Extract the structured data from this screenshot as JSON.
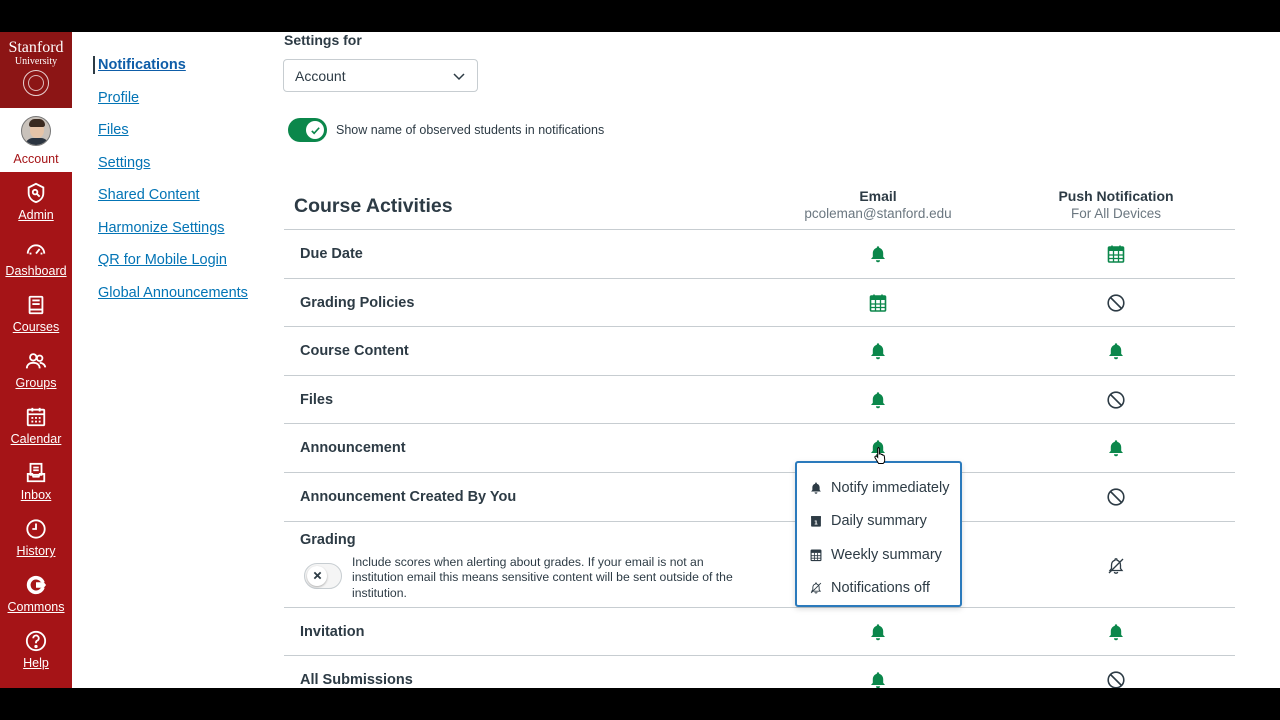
{
  "colors": {
    "nav_bg": "#a51417",
    "logo_bg": "#8c1515",
    "accent_green": "#0b874b",
    "link": "#0374b5",
    "menu_border": "#2b7abc"
  },
  "logo": {
    "line1": "Stanford",
    "line2": "University"
  },
  "global_nav": [
    {
      "label": "Account",
      "icon": "avatar"
    },
    {
      "label": "Admin",
      "icon": "shield-key-icon"
    },
    {
      "label": "Dashboard",
      "icon": "speedometer-icon"
    },
    {
      "label": "Courses",
      "icon": "book-icon"
    },
    {
      "label": "Groups",
      "icon": "people-icon"
    },
    {
      "label": "Calendar",
      "icon": "calendar-icon"
    },
    {
      "label": "Inbox",
      "icon": "inbox-icon"
    },
    {
      "label": "History",
      "icon": "clock-icon"
    },
    {
      "label": "Commons",
      "icon": "commons-icon"
    },
    {
      "label": "Help",
      "icon": "question-icon"
    }
  ],
  "sub_nav": [
    "Notifications",
    "Profile",
    "Files",
    "Settings",
    "Shared Content",
    "Harmonize Settings",
    "QR for Mobile Login",
    "Global Announcements"
  ],
  "settings_for": {
    "label": "Settings for",
    "selected": "Account"
  },
  "observed_toggle": {
    "label": "Show name of observed students in notifications",
    "on": true
  },
  "table": {
    "title": "Course Activities",
    "email_header": "Email",
    "email_sub": "pcoleman@stanford.edu",
    "push_header": "Push Notification",
    "push_sub": "For All Devices",
    "rows": [
      {
        "label": "Due Date",
        "email": "bell",
        "push": "calendar"
      },
      {
        "label": "Grading Policies",
        "email": "calendar",
        "push": "off"
      },
      {
        "label": "Course Content",
        "email": "bell",
        "push": "bell"
      },
      {
        "label": "Files",
        "email": "bell",
        "push": "off"
      },
      {
        "label": "Announcement",
        "email": "bell",
        "push": "bell"
      },
      {
        "label": "Announcement Created By You",
        "email": "",
        "push": "off"
      },
      {
        "label": "Grading",
        "email": "",
        "push": "muted-bell"
      },
      {
        "label": "Invitation",
        "email": "bell",
        "push": "bell"
      },
      {
        "label": "All Submissions",
        "email": "bell",
        "push": "off"
      }
    ],
    "grading_desc": "Include scores when alerting about grades. If your email is not an institution email this means sensitive content will be sent outside of the institution."
  },
  "menu": [
    {
      "label": "Notify immediately",
      "icon": "bell"
    },
    {
      "label": "Daily summary",
      "icon": "day"
    },
    {
      "label": "Weekly summary",
      "icon": "week"
    },
    {
      "label": "Notifications off",
      "icon": "muted-bell"
    }
  ]
}
